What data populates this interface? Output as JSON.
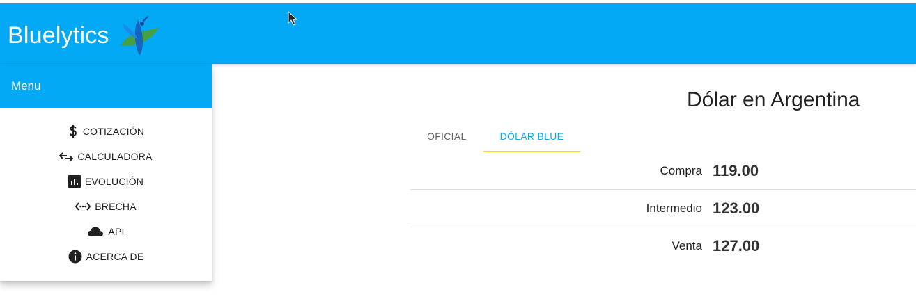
{
  "app": {
    "brand": "Bluelytics"
  },
  "drawer": {
    "title": "Menu",
    "items": [
      {
        "label": "COTIZACIÓN",
        "icon": "dollar-icon"
      },
      {
        "label": "CALCULADORA",
        "icon": "swap-arrows-icon"
      },
      {
        "label": "EVOLUCIÓN",
        "icon": "bar-chart-icon"
      },
      {
        "label": "BRECHA",
        "icon": "code-dots-icon"
      },
      {
        "label": "API",
        "icon": "cloud-icon"
      },
      {
        "label": "ACERCA DE",
        "icon": "info-icon"
      }
    ]
  },
  "main": {
    "title": "Dólar en Argentina",
    "tabs": [
      {
        "label": "OFICIAL",
        "active": false
      },
      {
        "label": "DÓLAR BLUE",
        "active": true
      }
    ],
    "rates": [
      {
        "label": "Compra",
        "value": "119.00"
      },
      {
        "label": "Intermedio",
        "value": "123.00"
      },
      {
        "label": "Venta",
        "value": "127.00"
      }
    ]
  },
  "colors": {
    "primary": "#03a9f4",
    "tab_indicator": "#fdd835",
    "text": "#212121"
  }
}
